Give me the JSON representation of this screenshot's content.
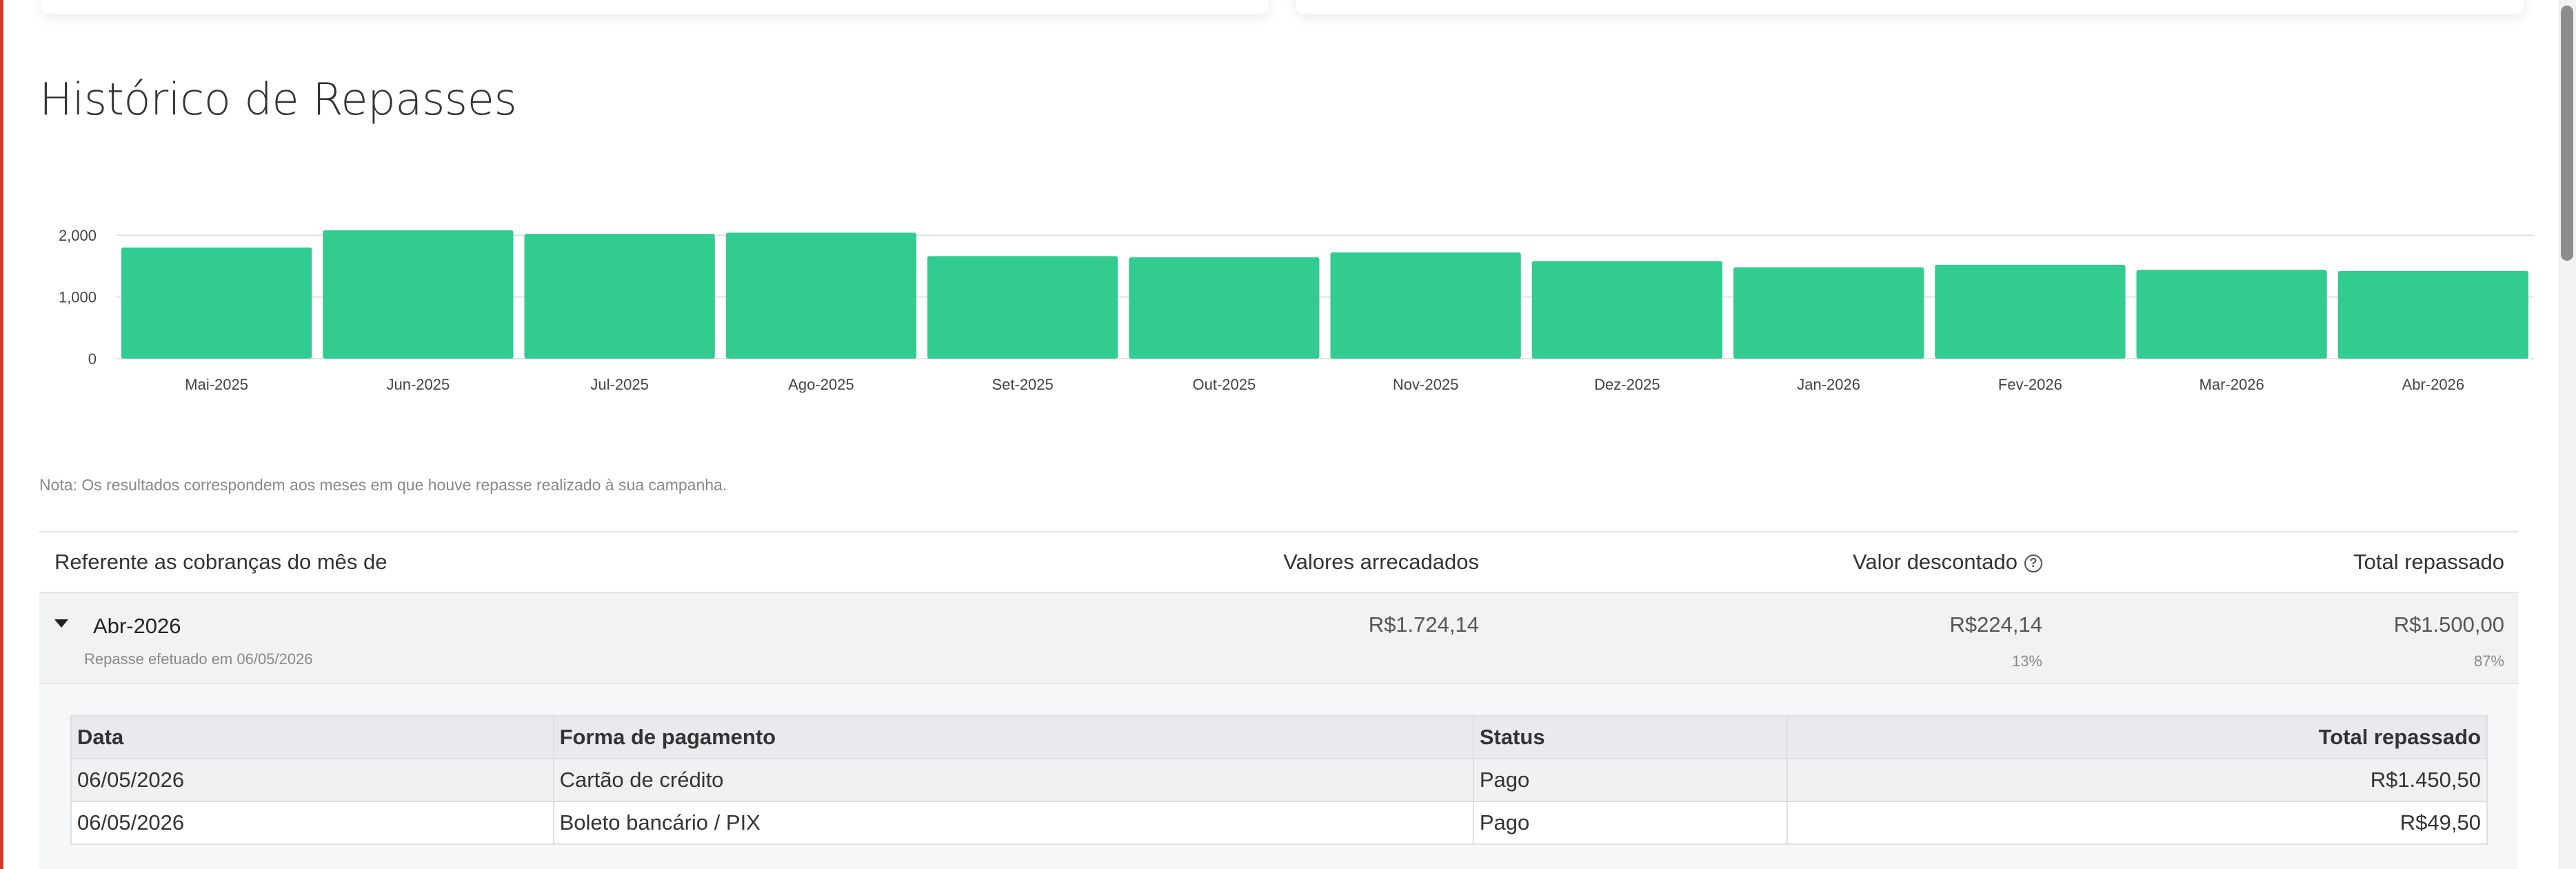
{
  "page": {
    "title": "Histórico de Repasses",
    "note": "Nota: Os resultados correspondem aos meses em que houve repasse realizado à sua campanha."
  },
  "chart_data": {
    "type": "bar",
    "categories": [
      "Mai-2025",
      "Jun-2025",
      "Jul-2025",
      "Ago-2025",
      "Set-2025",
      "Out-2025",
      "Nov-2025",
      "Dez-2025",
      "Jan-2026",
      "Fev-2026",
      "Mar-2026",
      "Abr-2026"
    ],
    "values": [
      1800,
      2080,
      2020,
      2040,
      1660,
      1640,
      1720,
      1580,
      1480,
      1520,
      1440,
      1420
    ],
    "yticks": [
      "0",
      "1,000",
      "2,000"
    ],
    "ylim": [
      0,
      2100
    ],
    "bar_color": "#33cc90",
    "grid": true
  },
  "summary": {
    "headers": {
      "month": "Referente as cobranças do mês de",
      "collected": "Valores arrecadados",
      "discounted": "Valor descontado",
      "total": "Total repassado"
    },
    "row": {
      "month": "Abr-2026",
      "subtitle": "Repasse efetuado em 06/05/2026",
      "collected": "R$1.724,14",
      "discounted": "R$224,14",
      "discounted_pct": "13%",
      "total": "R$1.500,00",
      "total_pct": "87%"
    }
  },
  "detail": {
    "headers": [
      "Data",
      "Forma de pagamento",
      "Status",
      "Total repassado"
    ],
    "rows": [
      [
        "06/05/2026",
        "Cartão de crédito",
        "Pago",
        "R$1.450,50"
      ],
      [
        "06/05/2026",
        "Boleto bancário / PIX",
        "Pago",
        "R$49,50"
      ]
    ]
  },
  "icons": {
    "help": "question-circle-icon",
    "expand": "caret-down-icon"
  }
}
